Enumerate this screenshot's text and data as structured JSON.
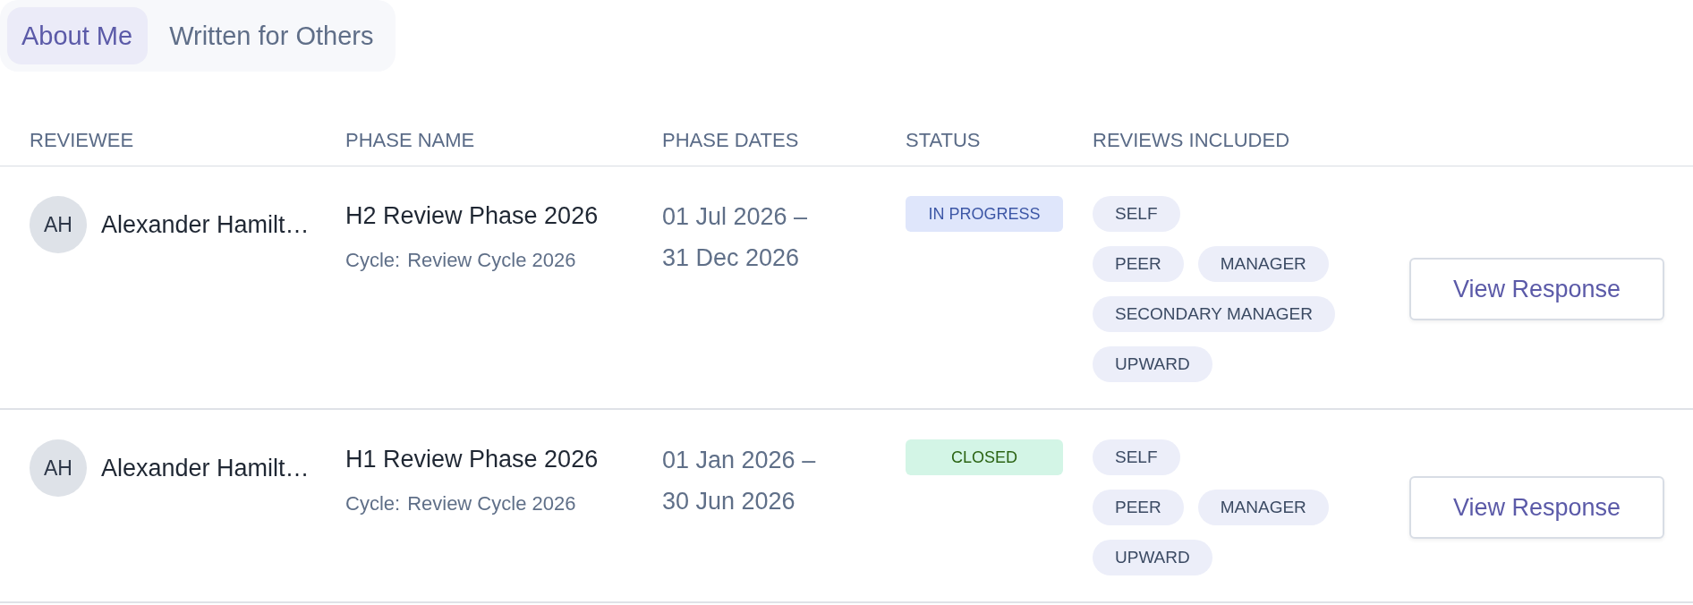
{
  "tabs": [
    {
      "label": "About Me",
      "selected": true
    },
    {
      "label": "Written for Others",
      "selected": false
    }
  ],
  "table": {
    "columns": [
      "REVIEWEE",
      "PHASE NAME",
      "PHASE DATES",
      "STATUS",
      "REVIEWS INCLUDED"
    ],
    "rows": [
      {
        "reviewee": {
          "initials": "AH",
          "name": "Alexander Hamilt…"
        },
        "phase_name": "H2 Review Phase 2026",
        "cycle_label": "Cycle:",
        "cycle": "Review Cycle 2026",
        "phase_dates": "01 Jul 2026 – 31 Dec 2026",
        "status": {
          "label": "IN PROGRESS",
          "kind": "in_progress"
        },
        "reviews_included": [
          [
            "SELF"
          ],
          [
            "PEER",
            "MANAGER"
          ],
          [
            "SECONDARY MANAGER"
          ],
          [
            "UPWARD"
          ]
        ],
        "action": "View Response"
      },
      {
        "reviewee": {
          "initials": "AH",
          "name": "Alexander Hamilt…"
        },
        "phase_name": "H1 Review Phase 2026",
        "cycle_label": "Cycle:",
        "cycle": "Review Cycle 2026",
        "phase_dates": "01 Jan 2026 – 30 Jun 2026",
        "status": {
          "label": "CLOSED",
          "kind": "closed"
        },
        "reviews_included": [
          [
            "SELF"
          ],
          [
            "PEER",
            "MANAGER"
          ],
          [
            "UPWARD"
          ]
        ],
        "action": "View Response"
      }
    ]
  }
}
